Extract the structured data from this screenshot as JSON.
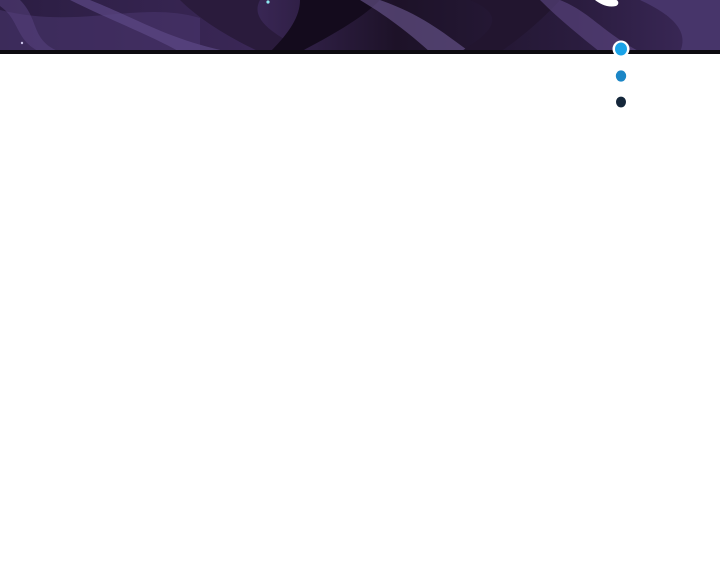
{
  "colors": {
    "page_background": "#ffffff",
    "panel_dark": "#1c1229",
    "panel_purple": "#3b2a58",
    "panel_highlight": "#6e5a95",
    "panel_border": "#0d0a10",
    "dot_bright": "#1aa3e8",
    "dot_mid": "#1b86c6",
    "dot_dark": "#14263a",
    "dot_outline": "#ffffff"
  },
  "icons": {
    "ellipsis": "ellipsis-dots-icon",
    "sparkle": "sparkle-icon"
  }
}
